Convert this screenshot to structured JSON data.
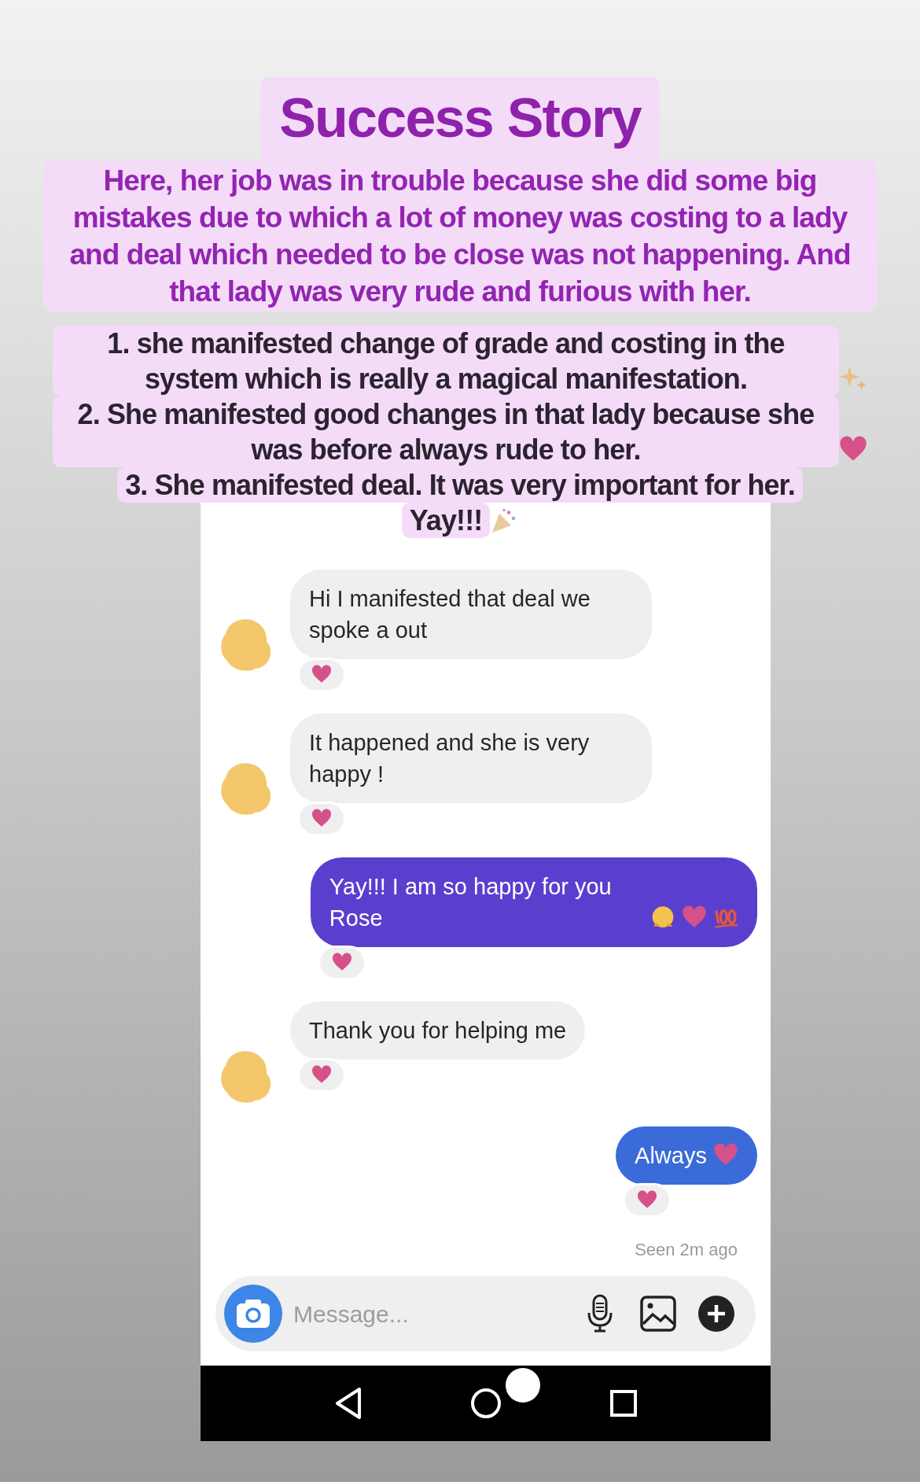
{
  "story": {
    "title": "Success Story",
    "intro": "Here, her job was in trouble because she did some big mistakes due to which a lot of money was costing to a lady and deal which needed to be close was not happening. And that lady was very rude and furious with her.",
    "points": [
      "1. she manifested change of grade and costing in the system which is really a magical manifestation.",
      "2. She manifested good changes in that lady because she was before always rude to her.",
      "3. She manifested deal. It was very important for her.",
      "Yay!!!"
    ]
  },
  "chat": {
    "messages": [
      {
        "kind": "received",
        "text": "Hi I manifested that deal we spoke a out"
      },
      {
        "kind": "received",
        "text": "It happened and she is very happy !"
      },
      {
        "kind": "sent",
        "color": "#5a3fcf",
        "text": "Yay!!! I am so happy for you Rose"
      },
      {
        "kind": "received",
        "text": "Thank you for helping me"
      },
      {
        "kind": "sent",
        "color": "#3a6bd9",
        "text": "Always"
      }
    ],
    "seen": "Seen 2m ago",
    "composer": {
      "placeholder": "Message..."
    }
  }
}
